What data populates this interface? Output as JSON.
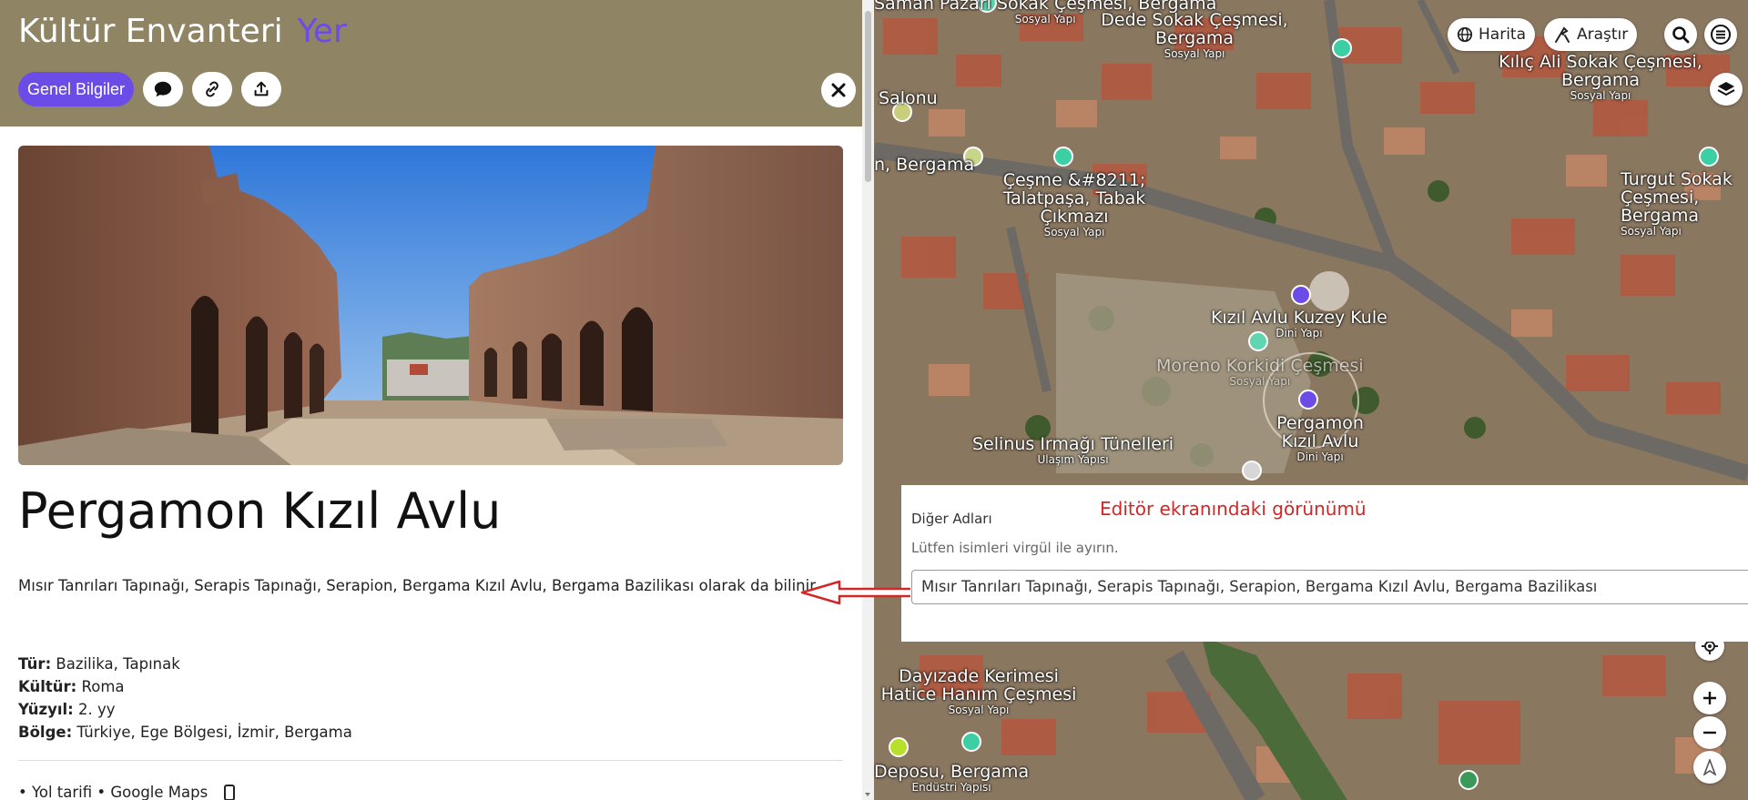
{
  "app": {
    "title": "Kültür Envanteri",
    "title_accent": "Yer",
    "header_color": "#8f8464",
    "accent_color": "#6b4ce6"
  },
  "header_actions": {
    "general_info_label": "Genel Bilgiler",
    "icons": [
      "comment-icon",
      "link-icon",
      "share-icon"
    ],
    "close_icon": "close-icon"
  },
  "place": {
    "title": "Pergamon Kızıl Avlu",
    "other_names_text": "Mısır Tanrıları Tapınağı, Serapis Tapınağı, Serapion, Bergama Kızıl Avlu, Bergama Bazilikası olarak da bilinir.",
    "properties": [
      {
        "key": "Tür:",
        "value": "Bazilika, Tapınak"
      },
      {
        "key": "Kültür:",
        "value": "Roma"
      },
      {
        "key": "Yüzyıl:",
        "value": "2. yy"
      },
      {
        "key": "Bölge:",
        "value": "Türkiye, Ege Bölgesi, İzmir, Bergama"
      }
    ],
    "links_text": "• Yol tarifi • Google Maps"
  },
  "map_controls": {
    "map_label": "Harita",
    "explore_label": "Araştır",
    "icons": [
      "globe-icon",
      "compass-icon",
      "search-icon",
      "menu-icon",
      "layers-icon",
      "locate-icon",
      "zoom-in-icon",
      "zoom-out-icon",
      "north-icon"
    ]
  },
  "map_labels": [
    {
      "name": "Saman Pazarı Sokak Çeşmesi, Bergama",
      "type": "Sosyal Yapı"
    },
    {
      "name": "Dede Sokak Çeşmesi, Bergama",
      "type": "Sosyal Yapı"
    },
    {
      "name": "Kılıç Ali Sokak Çeşmesi, Bergama",
      "type": "Sosyal Yapı"
    },
    {
      "name": "Turgut Sokak Çeşmesi, Bergama",
      "type": "Sosyal Yapı"
    },
    {
      "name": "Salonu",
      "type": ""
    },
    {
      "name": "n, Bergama",
      "type": ""
    },
    {
      "name": "Çeşme &#8211; Talatpaşa, Tabak Çıkmazı",
      "type": "Sosyal Yapı"
    },
    {
      "name": "Kızıl Avlu Kuzey Kule",
      "type": "Dini Yapı"
    },
    {
      "name": "Moreno Korkidi Çeşmesi",
      "type": "Sosyal Yapı"
    },
    {
      "name": "Pergamon Kızıl Avlu",
      "type": "Dini Yapı"
    },
    {
      "name": "Selinus Irmağı Tünelleri",
      "type": "Ulaşım Yapısı"
    },
    {
      "name": "Dayızade Kerimesi Hatice Hanım Çeşmesi",
      "type": "Sosyal Yapı"
    },
    {
      "name": "Deposu, Bergama",
      "type": "Endüstri Yapısı"
    }
  ],
  "editor": {
    "field_label": "Diğer Adları",
    "hint": "Lütfen isimleri virgül ile ayırın.",
    "note": "Editör ekranındaki görünümü",
    "input_value": "Mısır Tanrıları Tapınağı, Serapis Tapınağı, Serapion, Bergama Kızıl Avlu, Bergama Bazilikası"
  }
}
